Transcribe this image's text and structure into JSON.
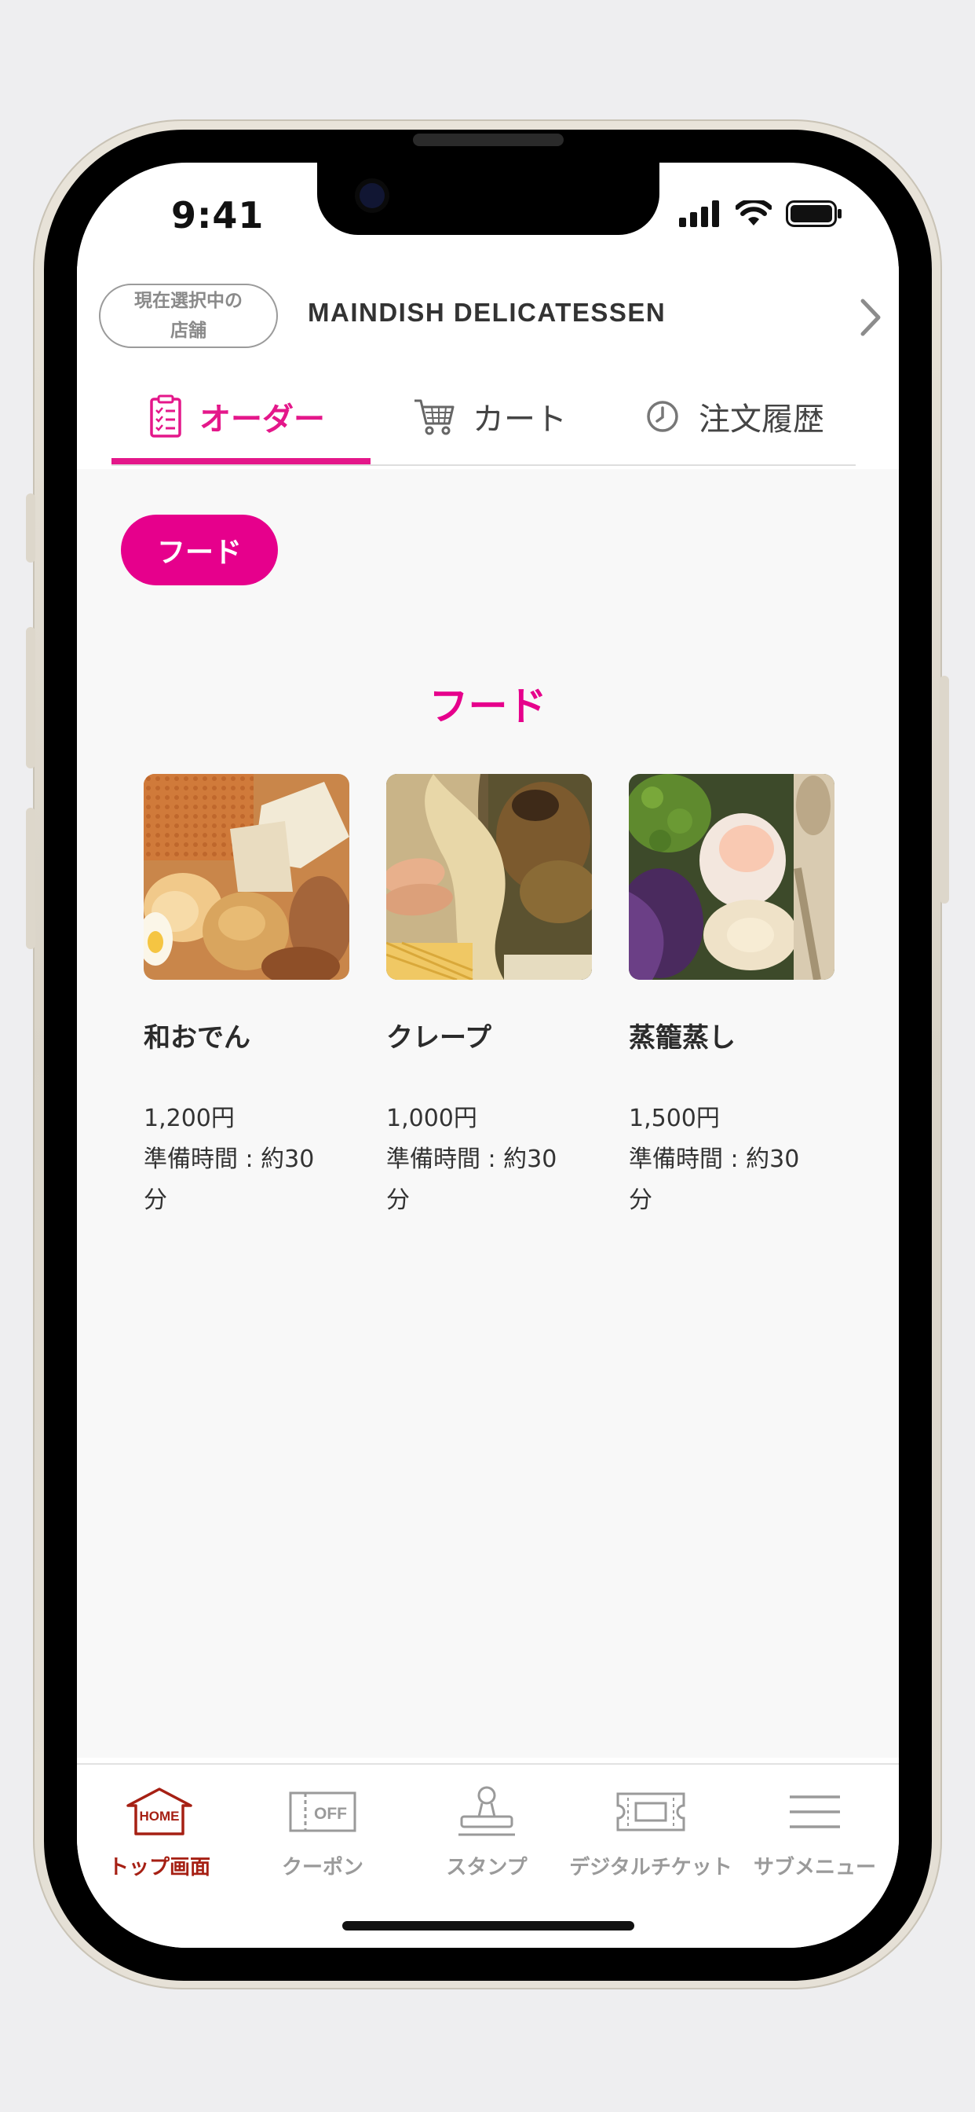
{
  "status": {
    "time": "9:41"
  },
  "store": {
    "pill_line1": "現在選択中の",
    "pill_line2": "店舗",
    "name": "MAINDISH DELICATESSEN"
  },
  "tabs": [
    {
      "label": "オーダー",
      "icon": "order-list-icon",
      "active": true
    },
    {
      "label": "カート",
      "icon": "cart-icon",
      "active": false
    },
    {
      "label": "注文履歴",
      "icon": "clock-icon",
      "active": false
    }
  ],
  "category_chip": "フード",
  "section_title": "フード",
  "items": [
    {
      "name": "和おでん",
      "price": "1,200円",
      "prep_line1": "準備時間 : 約30",
      "prep_line2": "分"
    },
    {
      "name": "クレープ",
      "price": "1,000円",
      "prep_line1": "準備時間 : 約30",
      "prep_line2": "分"
    },
    {
      "name": "蒸籠蒸し",
      "price": "1,500円",
      "prep_line1": "準備時間 : 約30",
      "prep_line2": "分"
    }
  ],
  "bottom_nav": [
    {
      "label": "トップ画面",
      "icon": "home-icon",
      "icon_text": "HOME",
      "active": true
    },
    {
      "label": "クーポン",
      "icon": "coupon-icon",
      "icon_text": "OFF",
      "active": false
    },
    {
      "label": "スタンプ",
      "icon": "stamp-icon",
      "active": false
    },
    {
      "label": "デジタルチケット",
      "icon": "ticket-icon",
      "active": false
    },
    {
      "label": "サブメニュー",
      "icon": "menu-icon",
      "active": false
    }
  ],
  "colors": {
    "accent": "#e6008c",
    "home_active": "#a62014",
    "inactive": "#9a9a9a"
  }
}
